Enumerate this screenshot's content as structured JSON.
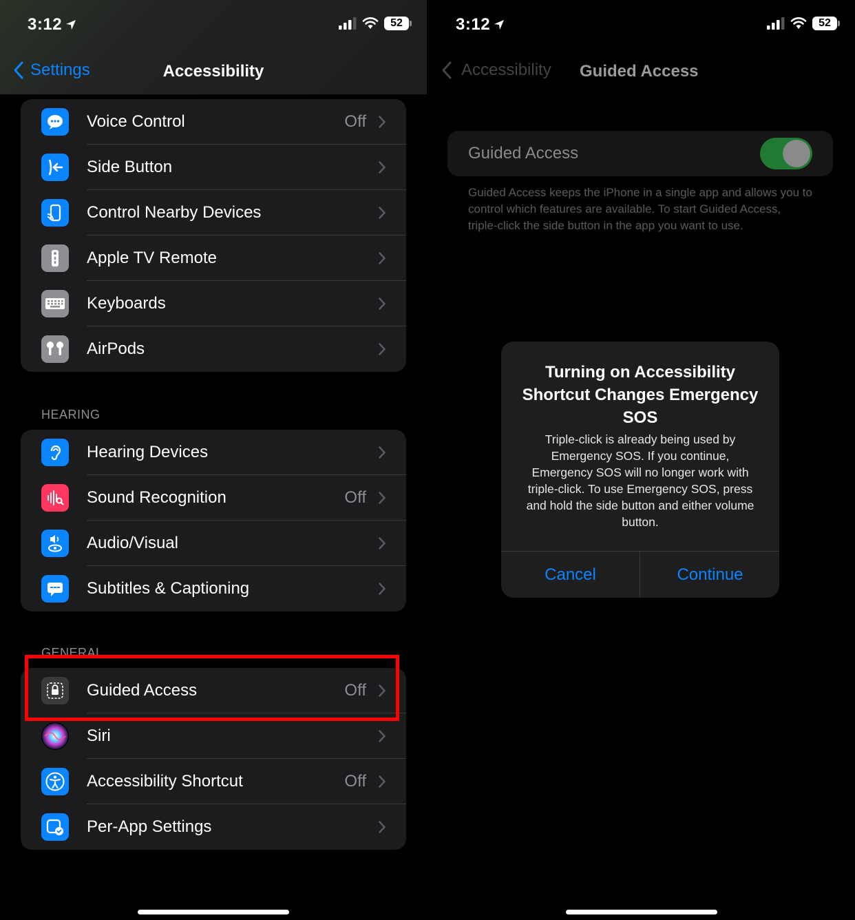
{
  "status_bar": {
    "time": "3:12",
    "battery": "52"
  },
  "left": {
    "nav": {
      "back_label": "Settings",
      "title": "Accessibility"
    },
    "group1": [
      {
        "label": "Voice Control",
        "value": "Off",
        "icon": "voice-control-icon",
        "color": "#0a84ff"
      },
      {
        "label": "Side Button",
        "value": "",
        "icon": "side-button-icon",
        "color": "#0a84ff"
      },
      {
        "label": "Control Nearby Devices",
        "value": "",
        "icon": "nearby-devices-icon",
        "color": "#0a84ff"
      },
      {
        "label": "Apple TV Remote",
        "value": "",
        "icon": "tv-remote-icon",
        "color": "#8e8e93"
      },
      {
        "label": "Keyboards",
        "value": "",
        "icon": "keyboard-icon",
        "color": "#8e8e93"
      },
      {
        "label": "AirPods",
        "value": "",
        "icon": "airpods-icon",
        "color": "#8e8e93"
      }
    ],
    "hearing_header": "HEARING",
    "hearing": [
      {
        "label": "Hearing Devices",
        "value": "",
        "icon": "ear-icon",
        "color": "#0a84ff"
      },
      {
        "label": "Sound Recognition",
        "value": "Off",
        "icon": "sound-recognition-icon",
        "color": "#ff375f"
      },
      {
        "label": "Audio/Visual",
        "value": "",
        "icon": "audio-visual-icon",
        "color": "#0a84ff"
      },
      {
        "label": "Subtitles & Captioning",
        "value": "",
        "icon": "captions-icon",
        "color": "#0a84ff"
      }
    ],
    "general_header": "GENERAL",
    "general": [
      {
        "label": "Guided Access",
        "value": "Off",
        "icon": "lock-icon",
        "color": "#3a3a3c"
      },
      {
        "label": "Siri",
        "value": "",
        "icon": "siri-icon",
        "color": "#000000"
      },
      {
        "label": "Accessibility Shortcut",
        "value": "Off",
        "icon": "accessibility-icon",
        "color": "#0a84ff"
      },
      {
        "label": "Per-App Settings",
        "value": "",
        "icon": "per-app-icon",
        "color": "#0a84ff"
      }
    ]
  },
  "right": {
    "nav": {
      "back_label": "Accessibility",
      "title": "Guided Access"
    },
    "toggle_label": "Guided Access",
    "toggle_on": true,
    "description": "Guided Access keeps the iPhone in a single app and allows you to control which features are available. To start Guided Access, triple-click the side button in the app you want to use.",
    "alert": {
      "title": "Turning on Accessibility Shortcut Changes Emergency SOS",
      "message": "Triple-click is already being used by Emergency SOS. If you continue, Emergency SOS will no longer work with triple-click. To use Emergency SOS, press and hold the side button and either volume button.",
      "cancel": "Cancel",
      "continue": "Continue"
    }
  }
}
